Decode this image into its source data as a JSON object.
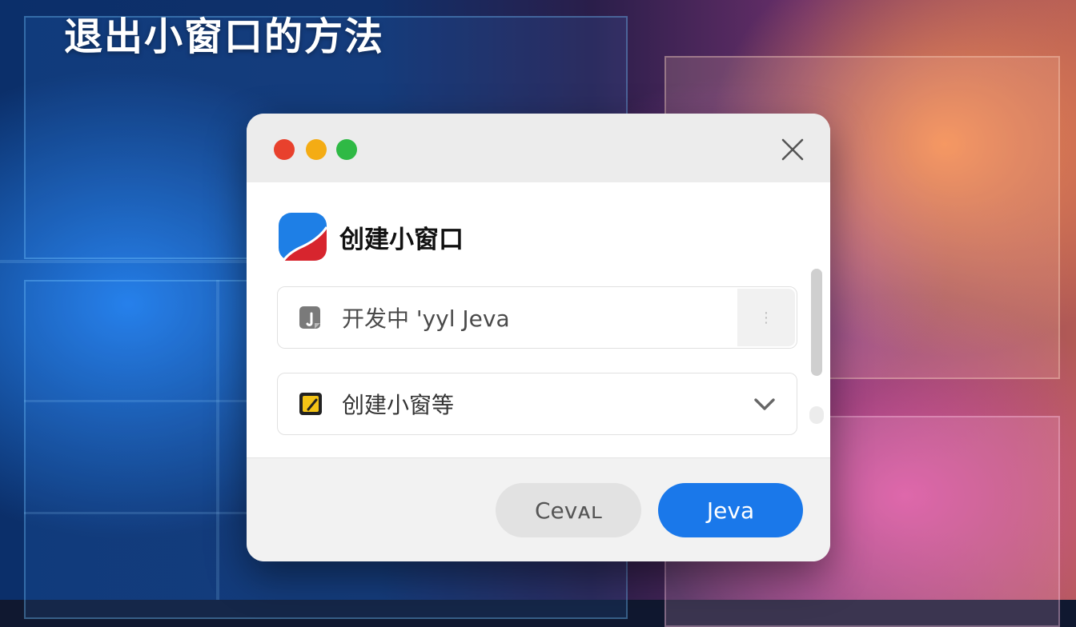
{
  "page": {
    "title": "退出小窗口的方法"
  },
  "dialog": {
    "header": {
      "title": "创建小窗口"
    },
    "fields": [
      {
        "icon": "document-icon",
        "text": "开发中 'yyl Jeva",
        "side_button": "⋮"
      },
      {
        "icon": "sticky-note-icon",
        "text": "创建小窗等",
        "control": "chevron-down-icon"
      }
    ],
    "buttons": {
      "cancel_label": "Cevᴀʟ",
      "primary_label": "Jeva"
    }
  },
  "colors": {
    "primary": "#1a78ea",
    "traffic_red": "#e8412d",
    "traffic_yellow": "#f4ac14",
    "traffic_green": "#2fb945",
    "logo_blue": "#1e7fe6",
    "logo_red": "#d7252e"
  }
}
